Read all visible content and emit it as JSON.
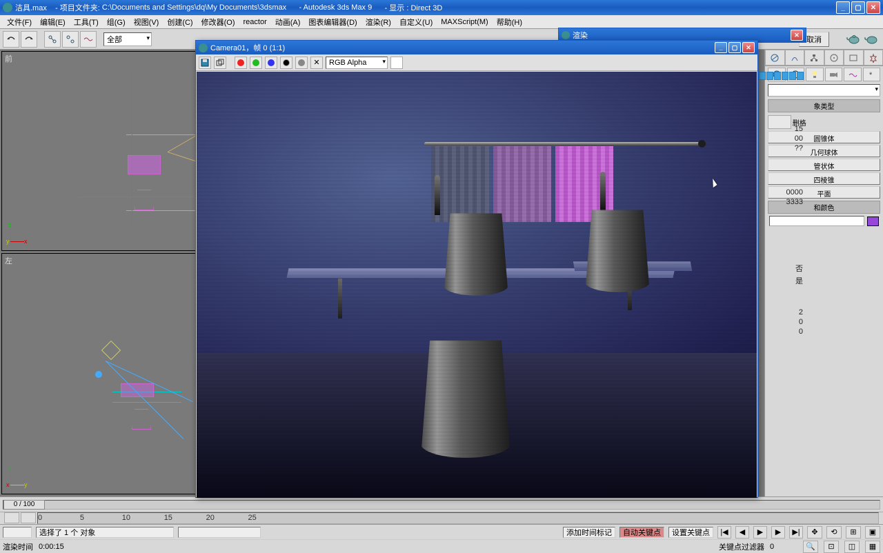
{
  "title": {
    "filename": "洁具.max",
    "project_label": "- 项目文件夹: ",
    "project_path": "C:\\Documents and Settings\\dq\\My Documents\\3dsmax",
    "app": "- Autodesk 3ds Max 9",
    "display": "- 显示 : Direct 3D"
  },
  "menu": [
    "文件(F)",
    "编辑(E)",
    "工具(T)",
    "组(G)",
    "视图(V)",
    "创建(C)",
    "修改器(O)",
    "reactor",
    "动画(A)",
    "图表编辑器(D)",
    "渲染(R)",
    "自定义(U)",
    "MAXScript(M)",
    "帮助(H)"
  ],
  "toolbar": {
    "selection_filter": "全部"
  },
  "viewports": {
    "top_left": "前",
    "bottom_left": "左"
  },
  "render_win": {
    "title": "Camera01，帧 0 (1:1)",
    "channel": "RGB Alpha"
  },
  "render_dlg": {
    "title": "渲染",
    "cancel": "取消"
  },
  "panel": {
    "type_header": "象类型",
    "grid_label": "删格",
    "objects": [
      "圆锥体",
      "几何球体",
      "管状体",
      "四棱锥",
      "平面"
    ],
    "color_header": "和颜色",
    "val15": "15",
    "val00": "00",
    "valqq": "??",
    "val0000": "0000",
    "val3333": "3333",
    "tog1": "否",
    "tog2": "是",
    "v2a": "2",
    "v2b": "0",
    "v2c": "0"
  },
  "timeline": {
    "slider": "0 / 100",
    "ticks": [
      "0",
      "5",
      "10",
      "15",
      "20",
      "25"
    ]
  },
  "status": {
    "selection": "选择了 1 个 对象",
    "add_marker": "添加时间标记",
    "auto_key": "自动关键点",
    "set_key": "设置关键点",
    "key_filter": "关键点过滤器",
    "render_time_label": "渲染时间",
    "render_time": "0:00:15",
    "frame": "0"
  },
  "colors": {
    "swatch": "#9548d8"
  }
}
